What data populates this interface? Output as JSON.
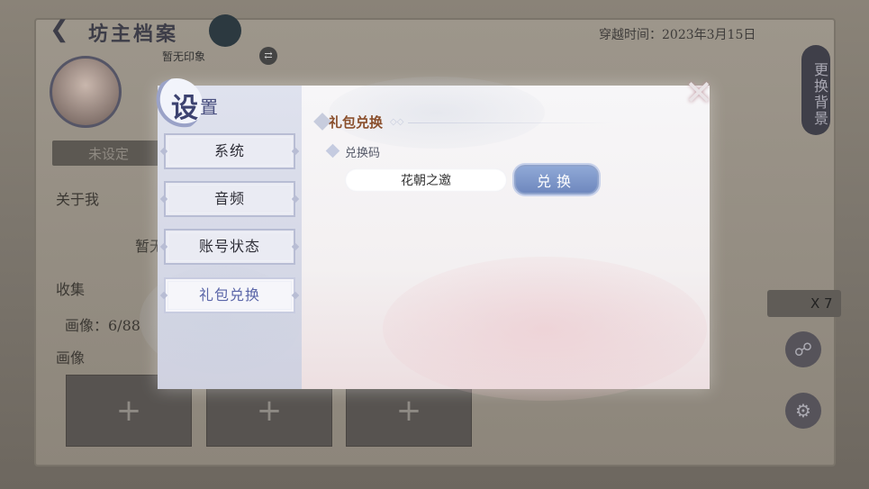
{
  "background": {
    "title": "坊主档案",
    "time_label": "穿越时间：2023年3月15日",
    "impression": "暂无印象",
    "unset_label": "未设定",
    "about_label": "关于我",
    "about_value": "暂无",
    "collect_label": "收集",
    "portrait_count": "画像：6/88",
    "portrait_label": "画像",
    "slots": [
      "+",
      "+",
      "+"
    ],
    "change_bg_label": "更换背景",
    "key_count": "X 7",
    "share_icon": "share-icon",
    "settings_icon": "gear-icon"
  },
  "modal": {
    "title_big": "设",
    "title_small": "置",
    "tabs": [
      {
        "label": "系统",
        "active": false
      },
      {
        "label": "音频",
        "active": false
      },
      {
        "label": "账号状态",
        "active": false
      },
      {
        "label": "礼包兑换",
        "active": true
      }
    ],
    "section_title": "礼包兑换",
    "code_label": "兑换码",
    "code_value": "花朝之邀",
    "redeem_label": "兑换",
    "close_icon": "close-icon",
    "accent_color": "#6f88be",
    "title_color": "#8a4f2c"
  }
}
